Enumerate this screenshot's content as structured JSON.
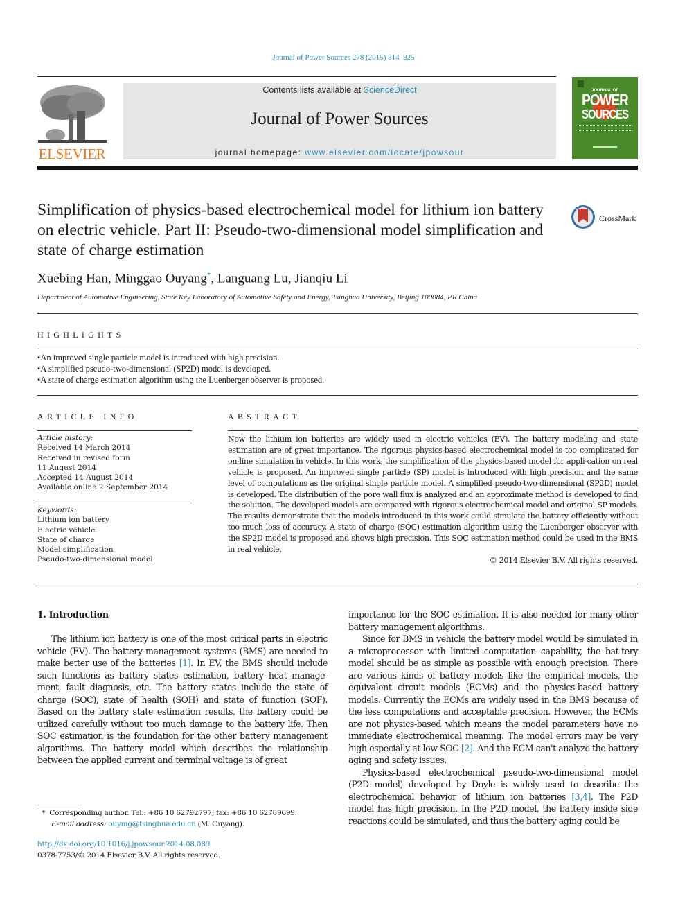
{
  "citation": "Journal of Power Sources 278 (2015) 814–825",
  "masthead": {
    "publisher": "ELSEVIER",
    "contents_prefix": "Contents lists available at ",
    "contents_link": "ScienceDirect",
    "journal_title": "Journal of Power Sources",
    "homepage_prefix": "journal homepage: ",
    "homepage_link": "www.elsevier.com/locate/jpowsour",
    "cover": {
      "line1": "JOURNAL OF",
      "line2": "POWER",
      "line3": "SOURCES"
    },
    "colors": {
      "brand_orange": "#f07a1a",
      "link_blue": "#2a8fbd",
      "cover_green": "#4b8a2a"
    }
  },
  "article": {
    "title": "Simplification of physics-based electrochemical model for lithium ion battery on electric vehicle. Part II: Pseudo-two-dimensional model simplification and state of charge estimation",
    "crossmark_label": "CrossMark",
    "authors": [
      {
        "name": "Xuebing Han",
        "sep": ", "
      },
      {
        "name": "Minggao Ouyang",
        "mark": "*",
        "sep": ", "
      },
      {
        "name": "Languang Lu",
        "sep": ", "
      },
      {
        "name": "Jianqiu Li",
        "sep": ""
      }
    ],
    "affiliation": "Department of Automotive Engineering, State Key Laboratory of Automotive Safety and Energy, Tsinghua University, Beijing 100084, PR China"
  },
  "highlights": {
    "heading": "HIGHLIGHTS",
    "items": [
      "An improved single particle model is introduced with high precision.",
      "A simplified pseudo-two-dimensional (SP2D) model is developed.",
      "A state of charge estimation algorithm using the Luenberger observer is proposed."
    ]
  },
  "article_info": {
    "heading": "ARTICLE INFO",
    "history_label": "Article history:",
    "history": [
      "Received 14 March 2014",
      "Received in revised form",
      "11 August 2014",
      "Accepted 14 August 2014",
      "Available online 2 September 2014"
    ],
    "keywords_label": "Keywords:",
    "keywords": [
      "Lithium ion battery",
      "Electric vehicle",
      "State of charge",
      "Model simplification",
      "Pseudo-two-dimensional model"
    ]
  },
  "abstract": {
    "heading": "ABSTRACT",
    "text": "Now the lithium ion batteries are widely used in electric vehicles (EV). The battery modeling and state estimation are of great importance. The rigorous physics-based electrochemical model is too complicated for on-line simulation in vehicle. In this work, the simplification of the physics-based model for appli-cation on real vehicle is proposed. An improved single particle (SP) model is introduced with high precision and the same level of computations as the original single particle model. A simplified pseudo-two-dimensional (SP2D) model is developed. The distribution of the pore wall flux is analyzed and an approximate method is developed to find the solution. The developed models are compared with rigorous electrochemical model and original SP models. The results demonstrate that the models introduced in this work could simulate the battery efficiently without too much loss of accuracy. A state of charge (SOC) estimation algorithm using the Luenberger observer with the SP2D model is proposed and shows high precision. This SOC estimation method could be used in the BMS in real vehicle.",
    "copyright": "© 2014 Elsevier B.V. All rights reserved."
  },
  "introduction": {
    "heading": "1.  Introduction",
    "col1": {
      "p1_a": "The lithium ion battery is one of the most critical parts in electric vehicle (EV). The battery management systems (BMS) are needed to make better use of the batteries ",
      "ref1": "[1]",
      "p1_b": ". In EV, the BMS should include such functions as battery states estimation, battery heat manage-ment, fault diagnosis, etc. The battery states include the state of charge (SOC), state of health (SOH) and state of function (SOF). Based on the battery state estimation results, the battery could be utilized carefully without too much damage to the battery life. Then SOC estimation is the foundation for the other battery management algorithms. The battery model which describes the relationship between the applied current and terminal voltage is of great"
    },
    "col2": {
      "p0": "importance for the SOC estimation. It is also needed for many other battery management algorithms.",
      "p2_a": "Since for BMS in vehicle the battery model would be simulated in a microprocessor with limited computation capability, the bat-tery model should be as simple as possible with enough precision. There are various kinds of battery models like the empirical models, the equivalent circuit models (ECMs) and the physics-based battery models. Currently the ECMs are widely used in the BMS because of the less computations and acceptable precision. However, the ECMs are not physics-based which means the model parameters have no immediate electrochemical meaning. The model errors may be very high especially at low SOC ",
      "ref2": "[2]",
      "p2_b": ". And the ECM can't analyze the battery aging and safety issues.",
      "p3_a": "Physics-based electrochemical pseudo-two-dimensional model (P2D model) developed by Doyle is widely used to describe the electrochemical behavior of lithium ion batteries ",
      "ref3": "[3,4]",
      "p3_b": ". The P2D model has high precision. In the P2D model, the battery inside side reactions could be simulated, and thus the battery aging could be"
    }
  },
  "footnote": {
    "mark": "*",
    "text": "Corresponding author. Tel.: +86 10 62792797; fax: +86 10 62789699.",
    "email_label": "E-mail address:",
    "email": "ouymg@tsinghua.edu.cn",
    "email_suffix": " (M. Ouyang)."
  },
  "doi": {
    "link": "http://dx.doi.org/10.1016/j.jpowsour.2014.08.089",
    "issn_line": "0378-7753/© 2014 Elsevier B.V. All rights reserved."
  }
}
